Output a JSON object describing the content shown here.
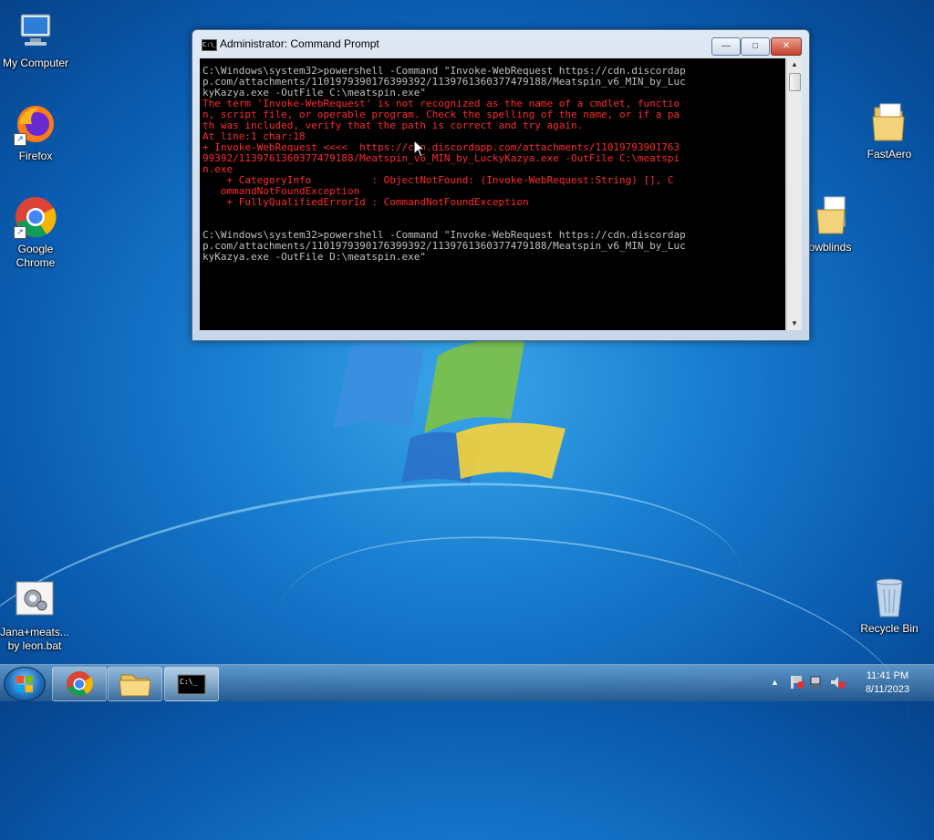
{
  "desktop": {
    "icons": [
      {
        "label": "My Computer"
      },
      {
        "label": "Firefox"
      },
      {
        "label": "Google Chrome"
      },
      {
        "label": "FastAero"
      },
      {
        "label": "owblinds"
      },
      {
        "label": "Jana+meats... by leon.bat"
      },
      {
        "label": "Recycle Bin"
      }
    ]
  },
  "cmd_window": {
    "title": "Administrator:  Command Prompt",
    "icon_label": "C:\\_",
    "min_label": "—",
    "max_label": "□",
    "close_label": "✕",
    "lines": [
      {
        "t": "C:\\Windows\\system32>powershell -Command \"Invoke-WebRequest https://cdn.discordap",
        "c": "w"
      },
      {
        "t": "p.com/attachments/1101979390176399392/1139761360377479188/Meatspin_v6_MIN_by_Luc",
        "c": "w"
      },
      {
        "t": "kyKazya.exe -OutFile C:\\meatspin.exe\"",
        "c": "w"
      },
      {
        "t": "The term 'Invoke-WebRequest' is not recognized as the name of a cmdlet, functio",
        "c": "r"
      },
      {
        "t": "n, script file, or operable program. Check the spelling of the name, or if a pa",
        "c": "r"
      },
      {
        "t": "th was included, verify that the path is correct and try again.",
        "c": "r"
      },
      {
        "t": "At line:1 char:18",
        "c": "r"
      },
      {
        "t": "+ Invoke-WebRequest <<<<  https://cdn.discordapp.com/attachments/11019793901763",
        "c": "r"
      },
      {
        "t": "99392/1139761360377479188/Meatspin_v6_MIN_by_LuckyKazya.exe -OutFile C:\\meatspi",
        "c": "r"
      },
      {
        "t": "n.exe",
        "c": "r"
      },
      {
        "t": "    + CategoryInfo          : ObjectNotFound: (Invoke-WebRequest:String) [], C",
        "c": "r"
      },
      {
        "t": "   ommandNotFoundException",
        "c": "r"
      },
      {
        "t": "    + FullyQualifiedErrorId : CommandNotFoundException",
        "c": "r"
      },
      {
        "t": "",
        "c": "w"
      },
      {
        "t": "",
        "c": "w"
      },
      {
        "t": "C:\\Windows\\system32>powershell -Command \"Invoke-WebRequest https://cdn.discordap",
        "c": "w"
      },
      {
        "t": "p.com/attachments/1101979390176399392/1139761360377479188/Meatspin_v6_MIN_by_Luc",
        "c": "w"
      },
      {
        "t": "kyKazya.exe -OutFile D:\\meatspin.exe\"",
        "c": "w"
      }
    ]
  },
  "taskbar": {
    "time": "11:41 PM",
    "date": "8/11/2023",
    "tray_arrow": "▲"
  },
  "colors": {
    "console_text": "#c0c0c0",
    "console_error": "#ff2a2a",
    "console_bg": "#000000"
  }
}
